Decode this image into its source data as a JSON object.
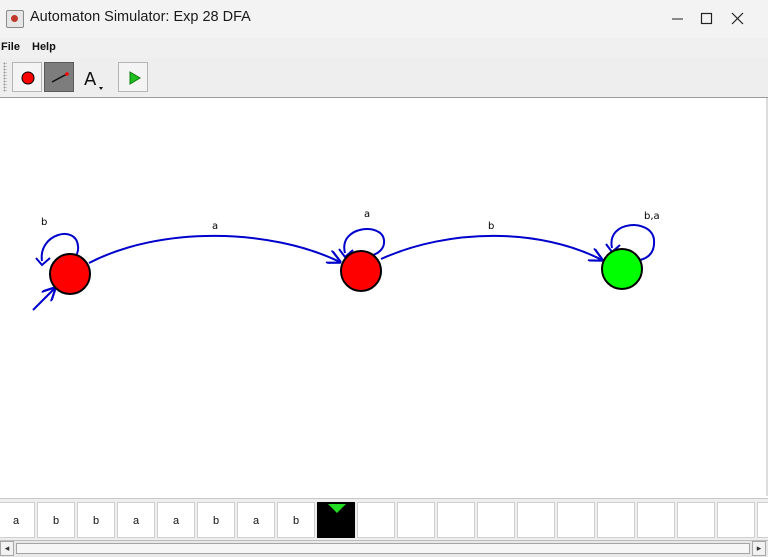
{
  "window": {
    "title": "Automaton Simulator: Exp 28 DFA"
  },
  "menu": {
    "items": [
      "File",
      "Help"
    ]
  },
  "toolbar": {
    "tools": [
      "state-tool",
      "transition-tool",
      "text-tool",
      "run-tool"
    ],
    "selected": "transition-tool"
  },
  "automaton": {
    "states": [
      {
        "id": "q0",
        "initial": true,
        "accepting": false,
        "color": "#ff0000"
      },
      {
        "id": "q1",
        "initial": false,
        "accepting": false,
        "color": "#ff0000"
      },
      {
        "id": "q2",
        "initial": false,
        "accepting": true,
        "color": "#00ff00"
      }
    ],
    "transitions": [
      {
        "from": "q0",
        "to": "q0",
        "label": "b"
      },
      {
        "from": "q0",
        "to": "q1",
        "label": "a"
      },
      {
        "from": "q1",
        "to": "q1",
        "label": "a"
      },
      {
        "from": "q1",
        "to": "q2",
        "label": "b"
      },
      {
        "from": "q2",
        "to": "q2",
        "label": "b,a"
      }
    ],
    "edge_color": "#0000cc"
  },
  "tape": {
    "symbols": [
      "a",
      "b",
      "b",
      "a",
      "a",
      "b",
      "a",
      "b",
      "",
      "",
      "",
      "",
      "",
      "",
      "",
      "",
      "",
      "",
      "",
      ""
    ],
    "head_index": 8,
    "head_color": "#22dd22"
  }
}
